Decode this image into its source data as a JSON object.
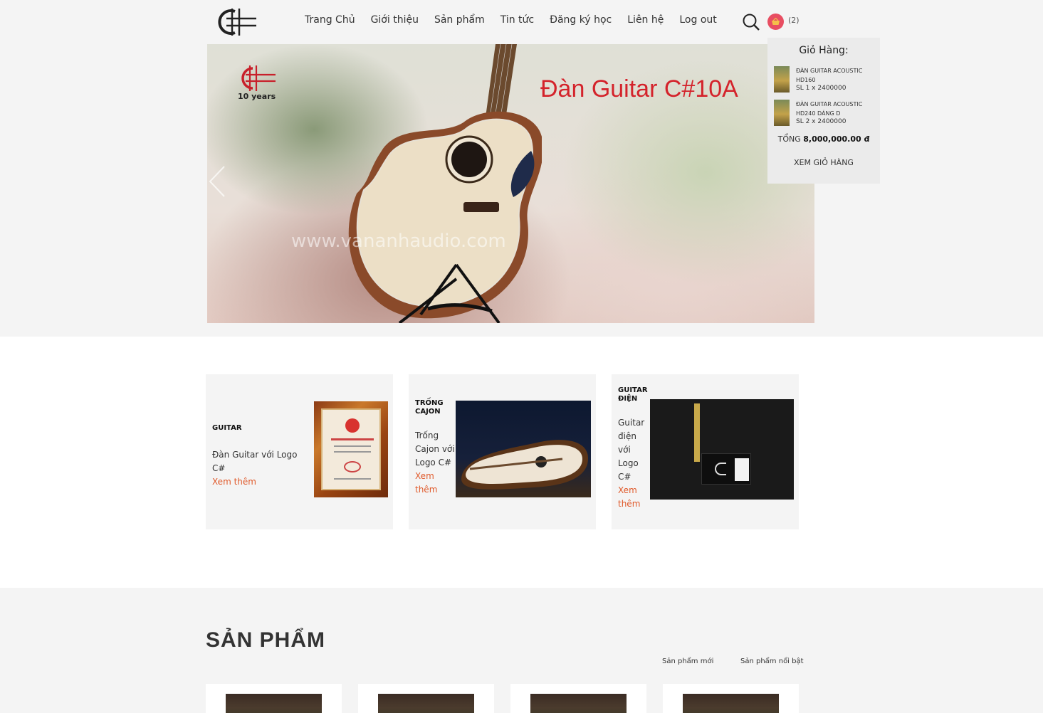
{
  "nav": {
    "items": [
      "Trang Chủ",
      "Giới thiệu",
      "Sản phẩm",
      "Tin tức",
      "Đăng ký học",
      "Liên hệ",
      "Log out"
    ],
    "cart_count": "(2)"
  },
  "hero": {
    "title": "Đàn Guitar C#10A",
    "logo_text": "10 years",
    "watermark": "www.vananhaudio.com"
  },
  "cart": {
    "title": "Giỏ Hàng:",
    "items": [
      {
        "name": "ĐÀN GUITAR ACOUSTIC HD160",
        "qty": "SL 1 x 2400000"
      },
      {
        "name": "ĐÀN GUITAR ACOUSTIC HD240 DÁNG D",
        "qty": "SL 2 x 2400000"
      }
    ],
    "total_label": "TỔNG",
    "total_value": "8,000,000.00 đ",
    "view_label": "XEM GIỎ HÀNG"
  },
  "categories": [
    {
      "name": "GUITAR",
      "desc": "Đàn Guitar với Logo C#",
      "more": "Xem thêm"
    },
    {
      "name": "TRỐNG CAJON",
      "desc": "Trống Cajon với Logo C#",
      "more": "Xem thêm"
    },
    {
      "name": "GUITAR ĐIỆN",
      "desc": "Guitar điện với Logo C#",
      "more": "Xem thêm"
    }
  ],
  "products": {
    "heading": "SẢN PHẨM",
    "tabs": [
      "Sản phẩm mới",
      "Sản phẩm nổi bật"
    ]
  },
  "colors": {
    "accent": "#e05a2b",
    "hero_title": "#d4232b",
    "cart_badge": "#e84e62"
  }
}
